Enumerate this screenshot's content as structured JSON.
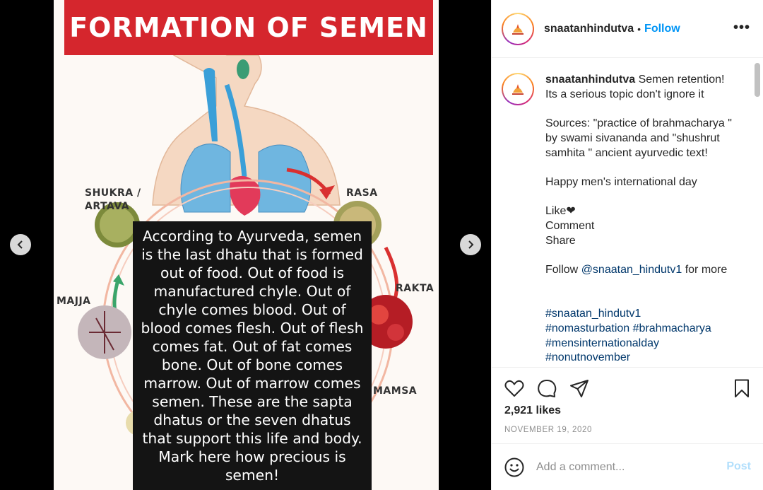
{
  "post": {
    "image_title": "FORMATION OF SEMEN",
    "diagram_labels": {
      "shukra": "SHUKRA /",
      "artava": "ARTAVA",
      "rasa": "RASA",
      "rakta": "RAKTA",
      "majja": "MAJJA",
      "mamsa": "MAMSA"
    },
    "overlay_text": "According to Ayurveda, semen is the last dhatu that is formed out of food. Out of food is manufactured chyle. Out of chyle comes blood. Out of blood comes flesh. Out of flesh comes fat. Out of fat comes bone. Out of bone comes marrow. Out of marrow comes semen. These are the sapta dhatus or the seven dhatus that support this life and body. Mark here how precious is semen!"
  },
  "header": {
    "username": "snaatanhindutva",
    "separator": "•",
    "follow_label": "Follow",
    "more_label": "•••"
  },
  "caption": {
    "username": "snaatanhindutva",
    "line1": "Semen retention! Its a serious topic don't ignore it",
    "sources": "Sources: \"practice of brahmacharya \" by swami sivananda and \"shushrut samhita \" ancient ayurvedic text!",
    "greeting": "Happy men's international day",
    "like": "Like❤",
    "comment": "Comment",
    "share": "Share",
    "follow_prefix": "Follow ",
    "follow_handle": "@snaatan_hindutv1",
    "follow_suffix": " for more",
    "hashtags_line1": "#snaatan_hindutv1",
    "hashtag_nomast": "#nomasturbation",
    "hashtag_brahma": "#brahmacharya",
    "hashtag_mens": "#mensinternationalday",
    "hashtag_nnn": "#nonutnovember"
  },
  "stats": {
    "likes": "2,921 likes",
    "date": "NOVEMBER 19, 2020"
  },
  "comment_box": {
    "placeholder": "Add a comment...",
    "post_label": "Post"
  },
  "icons": {
    "prev": "chevron-left-icon",
    "next": "chevron-right-icon",
    "like": "heart-icon",
    "comment": "comment-icon",
    "share": "paper-plane-icon",
    "save": "bookmark-icon",
    "emoji": "smiley-icon"
  },
  "colors": {
    "banner": "#d5262d",
    "follow": "#0095f6",
    "link": "#00376b",
    "post_disabled": "#b2dffc"
  }
}
